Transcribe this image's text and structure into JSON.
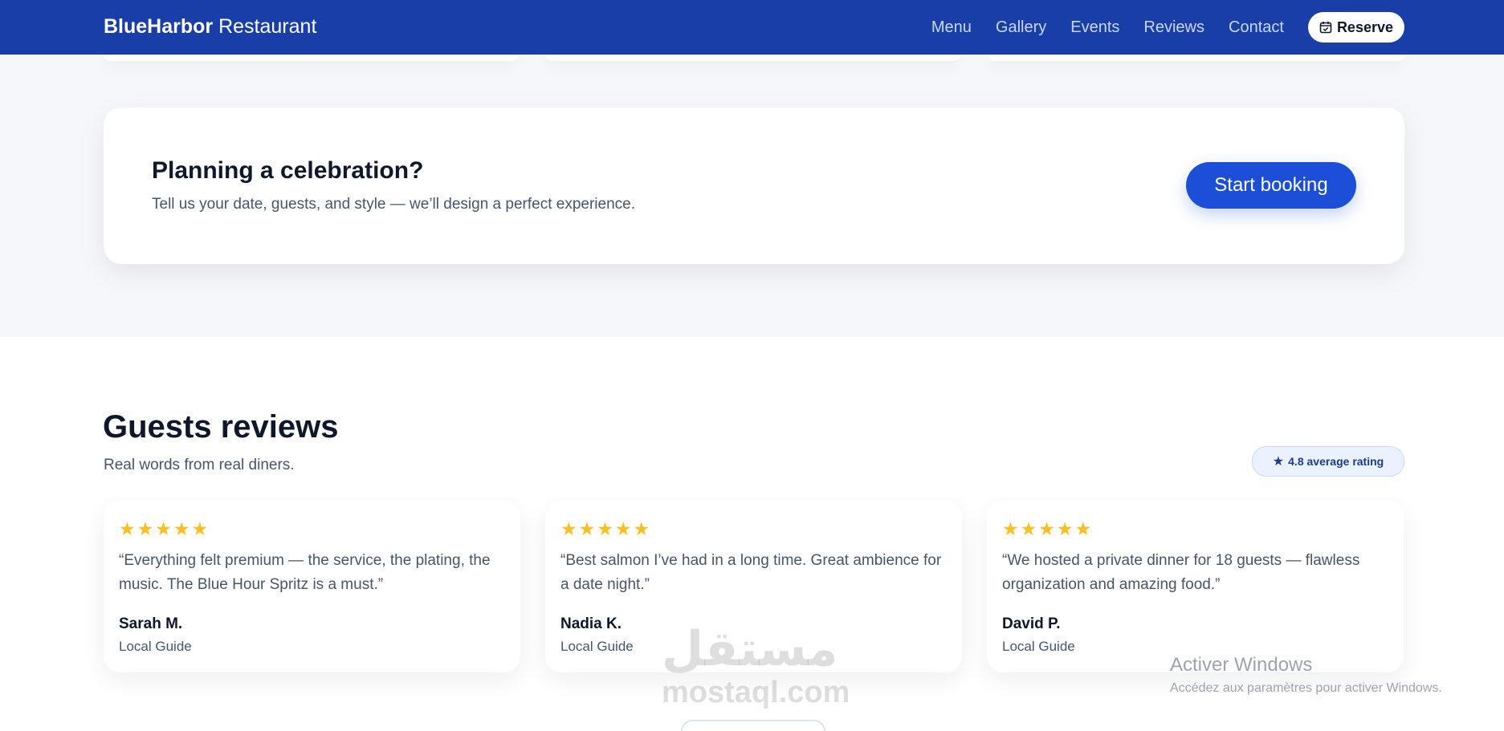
{
  "brand": {
    "bold": "BlueHarbor",
    "rest": "Restaurant"
  },
  "nav": {
    "items": [
      "Menu",
      "Gallery",
      "Events",
      "Reviews",
      "Contact"
    ],
    "reserve_label": "Reserve"
  },
  "cta": {
    "title": "Planning a celebration?",
    "subtitle": "Tell us your date, guests, and style — we’ll design a perfect experience.",
    "button": "Start booking"
  },
  "reviews": {
    "title": "Guests reviews",
    "subtitle": "Real words from real diners.",
    "rating_badge": "4.8 average rating",
    "items": [
      {
        "stars": 5,
        "quote": "“Everything felt premium — the service, the plating, the music. The Blue Hour Spritz is a must.”",
        "author": "Sarah M.",
        "role": "Local Guide"
      },
      {
        "stars": 5,
        "quote": "“Best salmon I’ve had in a long time. Great ambience for a date night.”",
        "author": "Nadia K.",
        "role": "Local Guide"
      },
      {
        "stars": 5,
        "quote": "“We hosted a private dinner for 18 guests — flawless organization and amazing food.”",
        "author": "David P.",
        "role": "Local Guide"
      }
    ]
  },
  "watermark": {
    "logo": "مستقل",
    "site": "mostaql.com"
  },
  "activation": {
    "title": "Activer Windows",
    "subtitle": "Accédez aux paramètres pour activer Windows."
  },
  "colors": {
    "header": "#1a3ea8",
    "accent": "#1d4ed8",
    "star": "#fbbf24"
  }
}
